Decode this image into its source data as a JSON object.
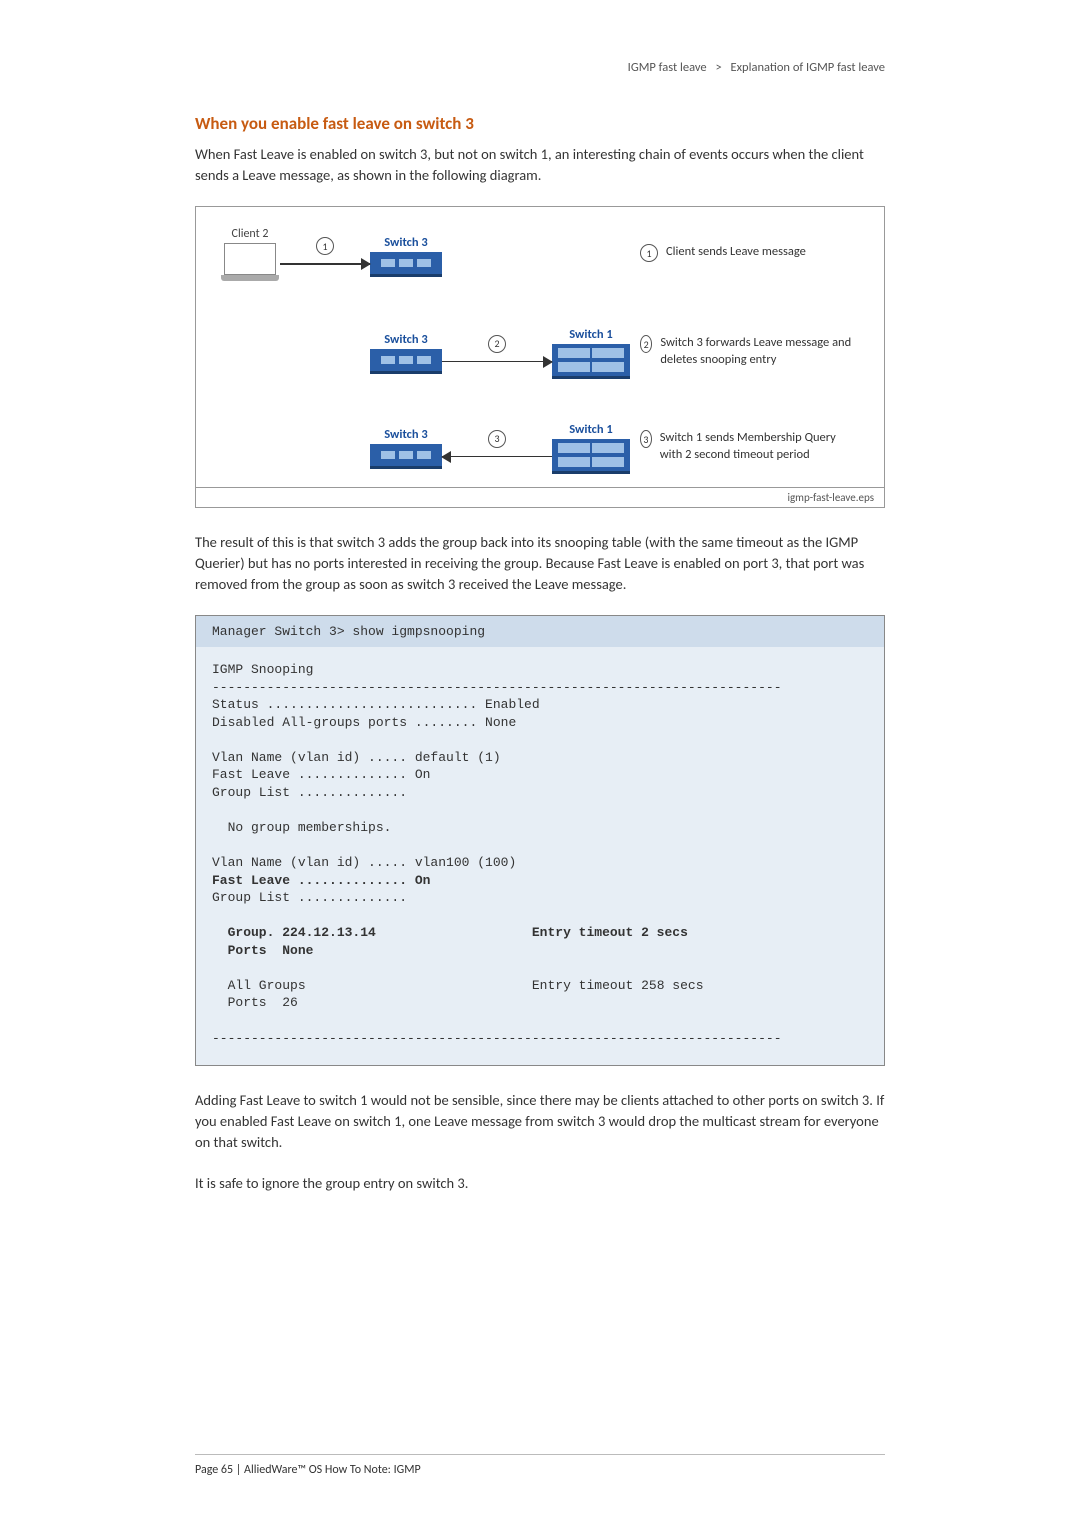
{
  "breadcrumb": {
    "a": "IGMP fast leave",
    "b": "Explanation of IGMP fast leave"
  },
  "heading": "When you enable fast leave on switch 3",
  "intro": "When Fast Leave is enabled on switch 3, but not on switch 1, an interesting chain of events occurs when the client sends a Leave message, as shown in the following diagram.",
  "diagram": {
    "client": "Client 2",
    "sw3": "Switch 3",
    "sw1": "Switch 1",
    "leg1": "Client sends Leave message",
    "leg2": "Switch 3 forwards Leave message and deletes snooping entry",
    "leg3": "Switch 1 sends Membership Query with 2 second timeout period",
    "fname": "igmp-fast-leave.eps",
    "n1": "1",
    "n2": "2",
    "n3": "3"
  },
  "mid": "The result of this is that switch 3 adds the group back into its snooping table (with the same timeout as the IGMP Querier) but has no ports interested in receiving the group. Because Fast Leave is enabled on port 3, that port was removed from the group as soon as switch 3 received the Leave message.",
  "code": {
    "cmd": "Manager Switch 3> show igmpsnooping",
    "l1": "IGMP Snooping",
    "hr": "-------------------------------------------------------------------------",
    "l2": "Status ........................... Enabled",
    "l3": "Disabled All-groups ports ........ None",
    "l4": "Vlan Name (vlan id) ..... default (1)",
    "l5": "Fast Leave .............. On",
    "l6": "Group List ..............",
    "l7": "  No group memberships.",
    "l8": "Vlan Name (vlan id) ..... vlan100 (100)",
    "l9": "Fast Leave .............. On",
    "l10": "Group List ..............",
    "l11a": "  Group. 224.12.13.14",
    "l11b": "Entry timeout 2 secs",
    "l12": "  Ports  None",
    "l13a": "  All Groups",
    "l13b": "Entry timeout 258 secs",
    "l14": "  Ports  26"
  },
  "after1": "Adding Fast Leave to switch 1 would not be sensible, since there may be clients attached to other ports on switch 3. If you enabled Fast Leave on switch 1, one Leave message from switch 3 would drop the multicast stream for everyone on that switch.",
  "after2": "It is safe to ignore the group entry on switch 3.",
  "footer": "Page 65 | AlliedWare™ OS How To Note: IGMP"
}
